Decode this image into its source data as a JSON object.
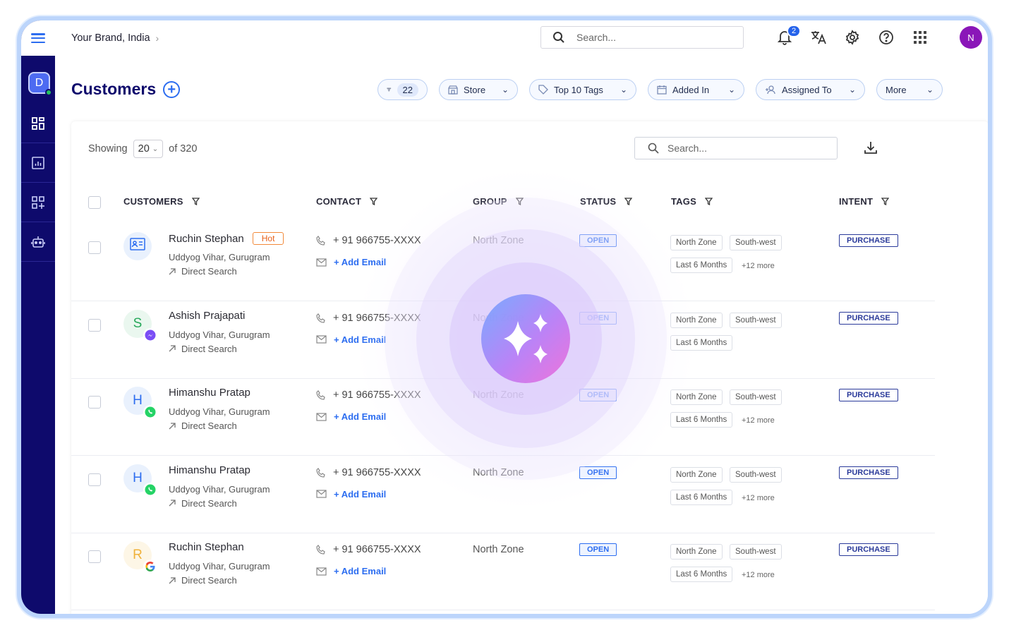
{
  "topbar": {
    "brand": "Your Brand, India",
    "search_placeholder": "Search...",
    "notifications_count": "2",
    "user_initial": "N"
  },
  "sidebar": {
    "workspace_initial": "D",
    "items": [
      "dashboard-icon",
      "reports-icon",
      "apps-icon",
      "bot-icon"
    ]
  },
  "page": {
    "title": "Customers",
    "filters": {
      "count": "22",
      "store": "Store",
      "tags": "Top 10 Tags",
      "added_in": "Added In",
      "assigned_to": "Assigned To",
      "more": "More"
    }
  },
  "table": {
    "showing_label": "Showing",
    "page_size": "20",
    "total": "of 320",
    "search_placeholder": "Search...",
    "headers": {
      "customers": "CUSTOMERS",
      "contact": "CONTACT",
      "group": "GROUP",
      "status": "STATUS",
      "tags": "TAGS",
      "intent": "INTENT"
    },
    "rows": [
      {
        "name": "Ruchin Stephan",
        "badge": "Hot",
        "address": "Uddyog Vihar, Gurugram",
        "source": "Direct Search",
        "phone": "+ 91 966755-XXXX",
        "email": "+ Add Email",
        "group": "North Zone",
        "status": "OPEN",
        "tag1": "North Zone",
        "tag2": "South-west",
        "tag3": "Last 6 Months",
        "more": "+12 more",
        "intent": "PURCHASE",
        "avatar": "",
        "channel": "contact-card-icon"
      },
      {
        "name": "Ashish Prajapati",
        "badge": "",
        "address": "Uddyog Vihar, Gurugram",
        "source": "Direct Search",
        "phone": "+ 91 966755-XXXX",
        "email": "+ Add Email",
        "group": "North Zone",
        "status": "OPEN",
        "tag1": "North Zone",
        "tag2": "South-west",
        "tag3": "Last 6 Months",
        "more": "",
        "intent": "PURCHASE",
        "avatar": "S",
        "channel": "messenger-icon"
      },
      {
        "name": "Himanshu Pratap",
        "badge": "",
        "address": "Uddyog Vihar, Gurugram",
        "source": "Direct Search",
        "phone": "+ 91 966755-XXXX",
        "email": "+ Add Email",
        "group": "North Zone",
        "status": "OPEN",
        "tag1": "North Zone",
        "tag2": "South-west",
        "tag3": "Last 6 Months",
        "more": "+12 more",
        "intent": "PURCHASE",
        "avatar": "H",
        "channel": "whatsapp-icon"
      },
      {
        "name": "Himanshu Pratap",
        "badge": "",
        "address": "Uddyog Vihar, Gurugram",
        "source": "Direct Search",
        "phone": "+ 91 966755-XXXX",
        "email": "+ Add Email",
        "group": "North Zone",
        "status": "OPEN",
        "tag1": "North Zone",
        "tag2": "South-west",
        "tag3": "Last 6 Months",
        "more": "+12 more",
        "intent": "PURCHASE",
        "avatar": "H",
        "channel": "whatsapp-icon"
      },
      {
        "name": "Ruchin Stephan",
        "badge": "",
        "address": "Uddyog Vihar, Gurugram",
        "source": "Direct Search",
        "phone": "+ 91 966755-XXXX",
        "email": "+ Add Email",
        "group": "North Zone",
        "status": "OPEN",
        "tag1": "North Zone",
        "tag2": "South-west",
        "tag3": "Last 6 Months",
        "more": "+12 more",
        "intent": "PURCHASE",
        "avatar": "R",
        "channel": "google-icon"
      }
    ]
  },
  "colors": {
    "sidebar": "#0e0a6c",
    "accent": "#2c6df0",
    "hot": "#e8621b",
    "frame": "#bcd5fb"
  }
}
